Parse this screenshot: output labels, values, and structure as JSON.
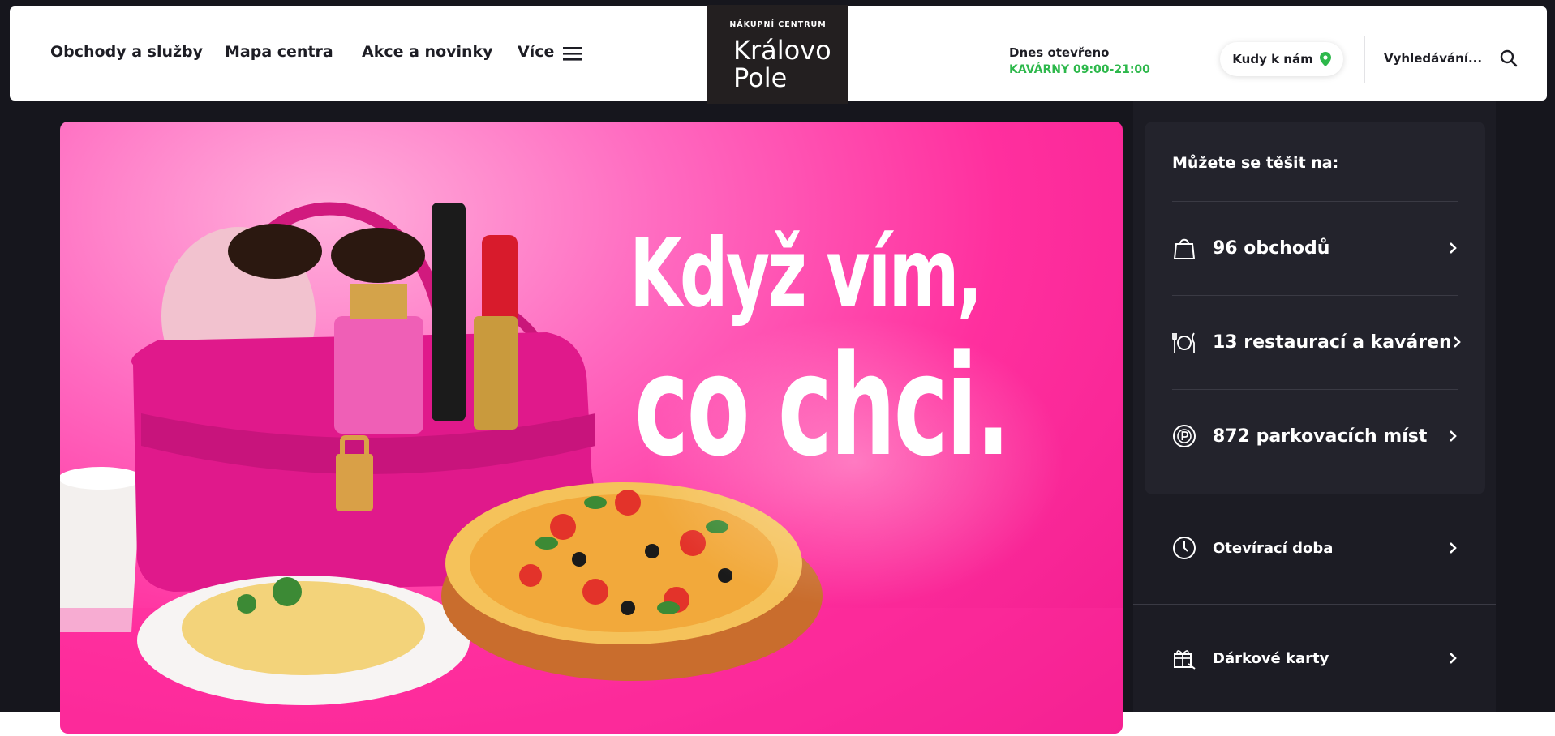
{
  "header": {
    "nav": [
      {
        "label": "Obchody a služby"
      },
      {
        "label": "Mapa centra"
      },
      {
        "label": "Akce a novinky"
      },
      {
        "label": "Více"
      }
    ],
    "logo": {
      "small": "NÁKUPNÍ CENTRUM",
      "line1": "Královo",
      "line2": "Pole"
    },
    "hours": {
      "title": "Dnes otevřeno",
      "value": "KAVÁRNY 09:00-21:00"
    },
    "directions_label": "Kudy k nám",
    "search": {
      "placeholder": "Vyhledávání..."
    }
  },
  "hero": {
    "line1": "Když vím,",
    "line2": "co chci."
  },
  "panel": {
    "title": "Můžete se těšit na:",
    "stats": [
      {
        "label": "96 obchodů",
        "icon": "shopping-bag-icon"
      },
      {
        "label": "13 restaurací a kaváren",
        "icon": "plate-cutlery-icon"
      },
      {
        "label": "872 parkovacích míst",
        "icon": "parking-icon"
      }
    ],
    "links": [
      {
        "label": "Otevírací doba",
        "icon": "clock-icon"
      },
      {
        "label": "Dárkové karty",
        "icon": "gift-card-icon"
      }
    ]
  },
  "colors": {
    "background": "#16161d",
    "accent_green": "#2db84b",
    "hero_pink": "#ff2f9e",
    "panel": "#23232c"
  }
}
